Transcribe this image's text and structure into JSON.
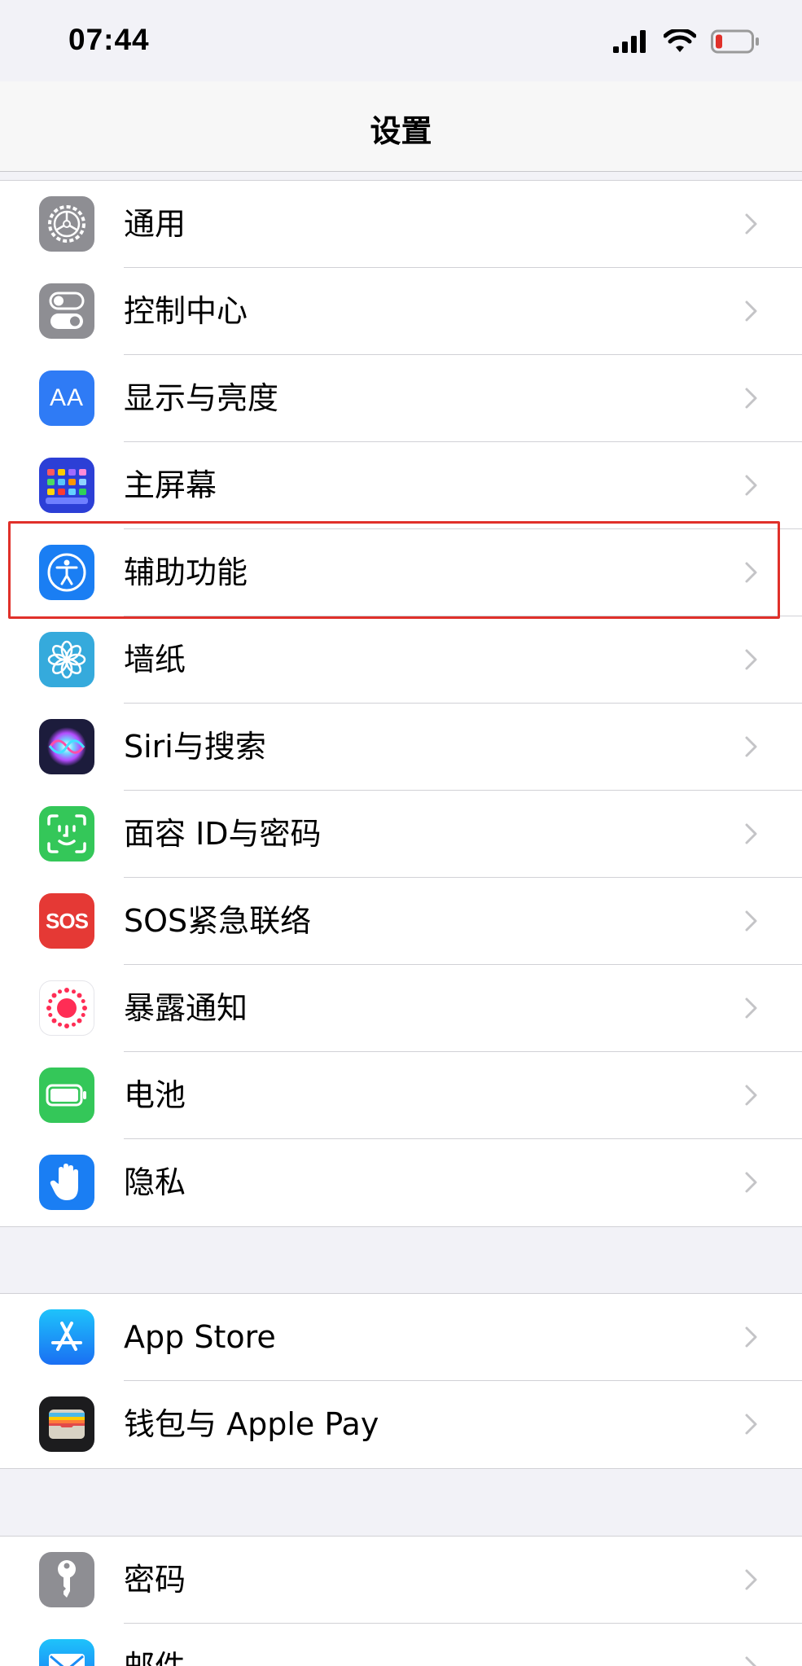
{
  "status_bar": {
    "time": "07:44",
    "icons": [
      "cellular-signal-icon",
      "wifi-icon",
      "battery-low-icon"
    ],
    "battery_color": "#e0302a"
  },
  "nav": {
    "title": "设置"
  },
  "groups": [
    {
      "items": [
        {
          "label": "通用",
          "icon": "gear-icon",
          "color": "#8e8e93"
        },
        {
          "label": "控制中心",
          "icon": "toggle-switches-icon",
          "color": "#8e8e93"
        },
        {
          "label": "显示与亮度",
          "icon": "text-size-icon",
          "color": "#2f7bf5",
          "icon_text": "AA"
        },
        {
          "label": "主屏幕",
          "icon": "app-grid-icon",
          "color": "#2c3fd6"
        },
        {
          "label": "辅助功能",
          "icon": "accessibility-icon",
          "color": "#1a7ef3"
        },
        {
          "label": "墙纸",
          "icon": "flower-icon",
          "color": "#35aadc"
        },
        {
          "label": "Siri与搜索",
          "icon": "siri-icon",
          "color": "#1c1c3c"
        },
        {
          "label": "面容 ID与密码",
          "icon": "face-id-icon",
          "color": "#34c759"
        },
        {
          "label": "SOS紧急联络",
          "icon": "sos-icon",
          "color": "#e53935",
          "icon_text": "SOS"
        },
        {
          "label": "暴露通知",
          "icon": "exposure-notification-icon",
          "color": "#ffffff"
        },
        {
          "label": "电池",
          "icon": "battery-icon",
          "color": "#34c759"
        },
        {
          "label": "隐私",
          "icon": "hand-icon",
          "color": "#1a7ef3"
        }
      ]
    },
    {
      "items": [
        {
          "label": "App Store",
          "icon": "app-store-icon",
          "color": "#1a8cf5"
        },
        {
          "label": "钱包与 Apple Pay",
          "icon": "wallet-icon",
          "color": "#1c1c1e"
        }
      ]
    },
    {
      "items": [
        {
          "label": "密码",
          "icon": "key-icon",
          "color": "#8e8e93"
        },
        {
          "label": "邮件",
          "icon": "mail-icon",
          "color": "#1a7ef3"
        }
      ]
    }
  ],
  "highlighted_item": "辅助功能"
}
